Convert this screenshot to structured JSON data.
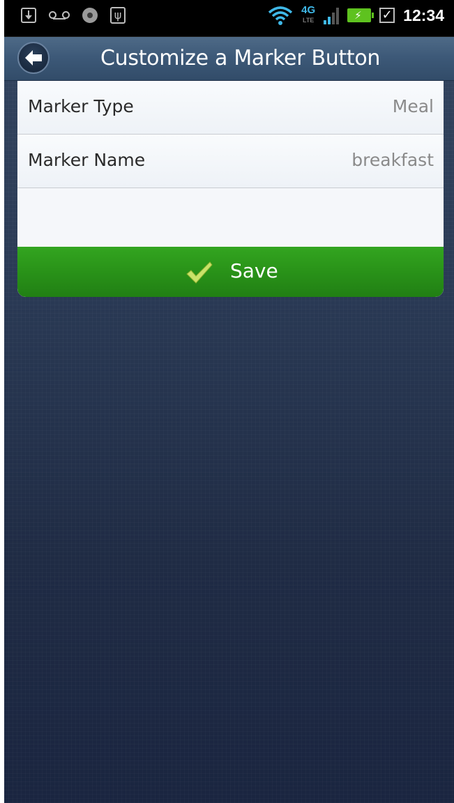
{
  "status_bar": {
    "time": "12:34",
    "network": "4G",
    "network_sub": "LTE",
    "icons": [
      "download-icon",
      "voicemail-icon",
      "media-icon",
      "usb-icon",
      "wifi-icon",
      "4g-lte-icon",
      "signal-icon",
      "battery-charging-icon",
      "checkbox-icon"
    ]
  },
  "header": {
    "title": "Customize a Marker Button",
    "back_icon": "back-arrow-icon"
  },
  "form": {
    "rows": [
      {
        "label": "Marker Type",
        "value": "Meal"
      },
      {
        "label": "Marker Name",
        "value": "breakfast"
      }
    ],
    "save_label": "Save"
  },
  "colors": {
    "save_green": "#2a9419",
    "title_bar": "#3c5877",
    "background": "#26344d"
  }
}
